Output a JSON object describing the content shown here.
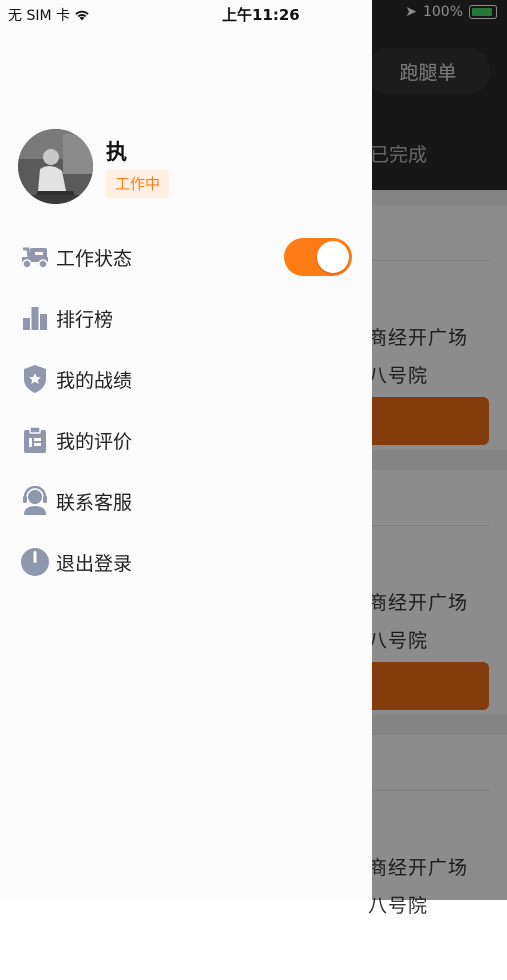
{
  "status_bar": {
    "carrier": "无 SIM 卡",
    "time": "上午11:26",
    "battery": "100%"
  },
  "background_app": {
    "title": "跑腿单",
    "tab": "已完成",
    "orders": [
      {
        "address_line1": "商经开广场",
        "address_line2": "八号院"
      },
      {
        "address_line1": "商经开广场",
        "address_line2": "八号院"
      },
      {
        "address_line1": "商经开广场",
        "address_line2": "八号院"
      }
    ]
  },
  "profile": {
    "name": "执",
    "status": "工作中"
  },
  "menu": {
    "work_status": "工作状态",
    "leaderboard": "排行榜",
    "my_record": "我的战绩",
    "my_reviews": "我的评价",
    "contact_service": "联系客服",
    "logout": "退出登录"
  },
  "work_toggle_on": true,
  "colors": {
    "accent": "#FF7B16",
    "icon": "#8E97AE",
    "badge_bg": "#FFF0E4"
  },
  "icons": [
    "delivery-scooter-icon",
    "bar-chart-icon",
    "shield-star-icon",
    "clipboard-icon",
    "headset-icon",
    "power-icon"
  ]
}
